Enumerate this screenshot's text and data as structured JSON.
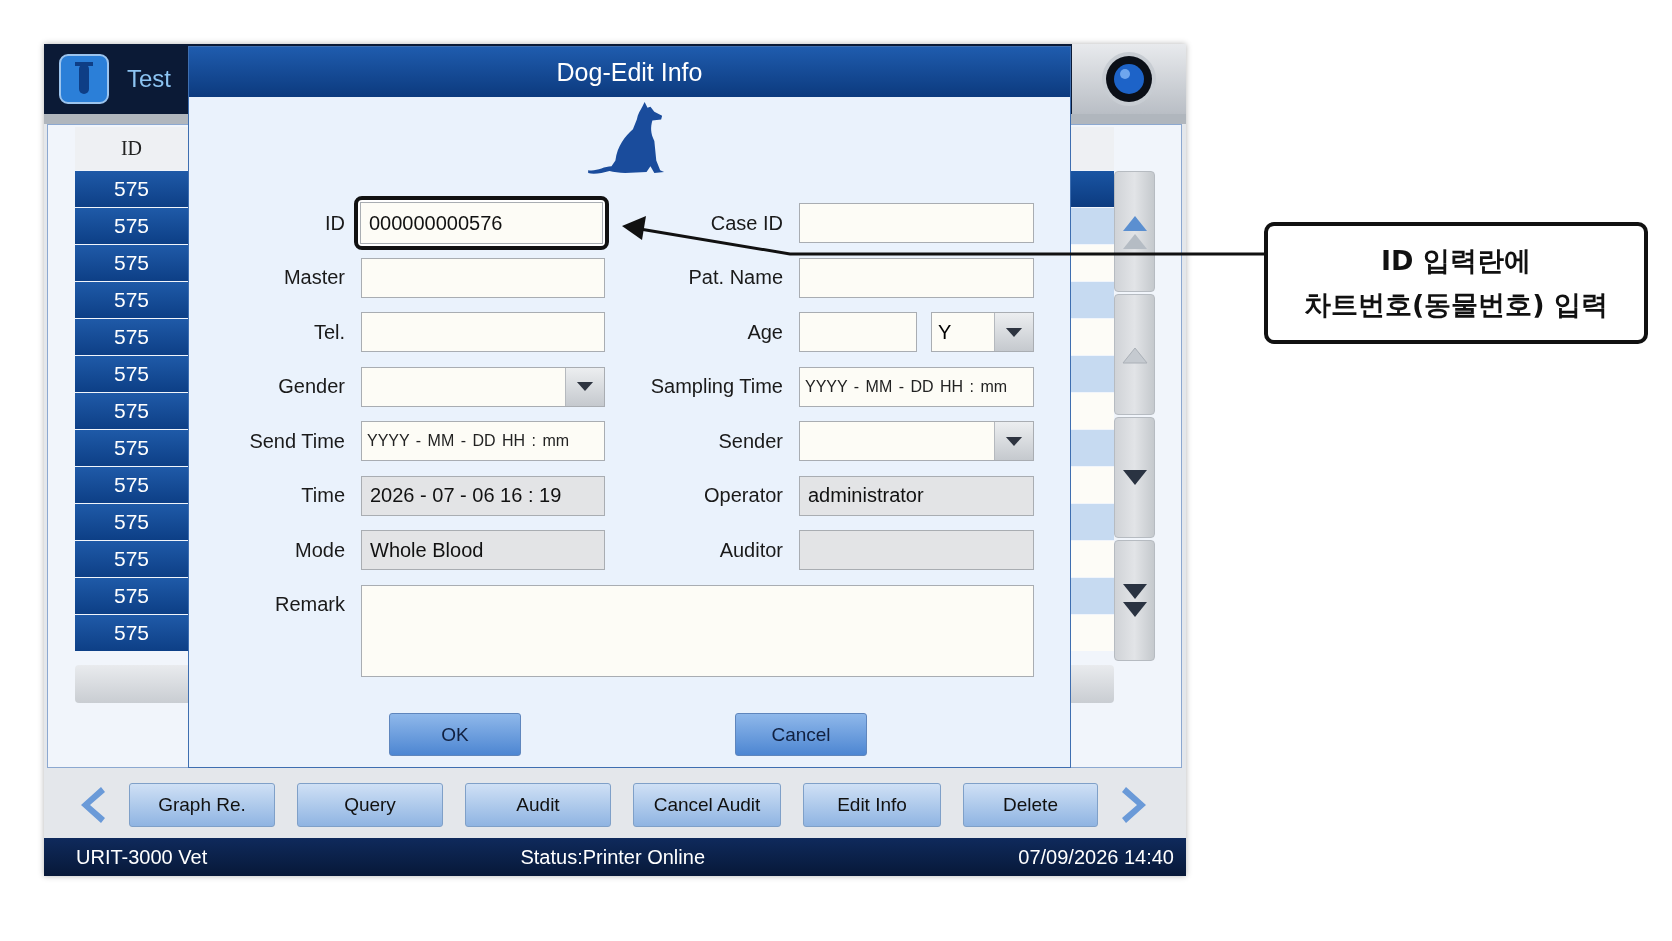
{
  "app": {
    "title": "Test"
  },
  "table": {
    "columns": [
      "ID"
    ],
    "rows": [
      {
        "id": "575",
        "selected": true
      },
      {
        "id": "575",
        "selected": false
      },
      {
        "id": "575",
        "selected": false
      },
      {
        "id": "575",
        "selected": false
      },
      {
        "id": "575",
        "selected": false
      },
      {
        "id": "575",
        "selected": false
      },
      {
        "id": "575",
        "selected": false
      },
      {
        "id": "575",
        "selected": false
      },
      {
        "id": "575",
        "selected": false
      },
      {
        "id": "575",
        "selected": false
      },
      {
        "id": "575",
        "selected": false
      },
      {
        "id": "575",
        "selected": false
      },
      {
        "id": "575",
        "selected": false
      }
    ]
  },
  "dialog": {
    "title": "Dog-Edit Info",
    "fields": [
      {
        "label": "ID",
        "kind": "text",
        "value": "000000000576",
        "readonly": false,
        "highlighted": true
      },
      {
        "label": "Case ID",
        "kind": "text",
        "readonly": false,
        "highlighted": false
      },
      {
        "label": "Master",
        "kind": "text",
        "readonly": false,
        "highlighted": false
      },
      {
        "label": "Pat. Name",
        "kind": "text",
        "readonly": false,
        "highlighted": false
      },
      {
        "label": "Tel.",
        "kind": "text",
        "readonly": false,
        "highlighted": false
      },
      {
        "label": "Age",
        "kind": "age",
        "unit": "Y",
        "readonly": false,
        "highlighted": false
      },
      {
        "label": "Gender",
        "kind": "dropdown",
        "readonly": false,
        "highlighted": false
      },
      {
        "label": "Sampling Time",
        "kind": "text",
        "placeholder": "YYYY - MM - DD HH : mm",
        "readonly": false,
        "highlighted": false
      },
      {
        "label": "Send Time",
        "kind": "text",
        "placeholder": "YYYY - MM - DD HH : mm",
        "readonly": false,
        "highlighted": false
      },
      {
        "label": "Sender",
        "kind": "dropdown",
        "readonly": false,
        "highlighted": false
      },
      {
        "label": "Time",
        "kind": "text",
        "value": "2026 - 07 - 06 16 : 19",
        "readonly": true,
        "highlighted": false
      },
      {
        "label": "Operator",
        "kind": "text",
        "value": "administrator",
        "readonly": true,
        "highlighted": false
      },
      {
        "label": "Mode",
        "kind": "text",
        "value": "Whole Blood",
        "readonly": true,
        "highlighted": false
      },
      {
        "label": "Auditor",
        "kind": "text",
        "readonly": true,
        "highlighted": false
      },
      {
        "label": "Remark",
        "kind": "textarea",
        "readonly": false,
        "highlighted": false
      }
    ],
    "buttons": [
      "OK",
      "Cancel"
    ]
  },
  "toolbar": [
    "Graph Re.",
    "Query",
    "Audit",
    "Cancel Audit",
    "Edit Info",
    "Delete"
  ],
  "status_bar": {
    "model": "URIT-3000 Vet",
    "status": "Status:Printer Online",
    "datetime": "07/09/2026 14:40"
  },
  "annotation": {
    "lines": [
      "ID 입력란에",
      "차트번호(동물번호) 입력"
    ]
  }
}
